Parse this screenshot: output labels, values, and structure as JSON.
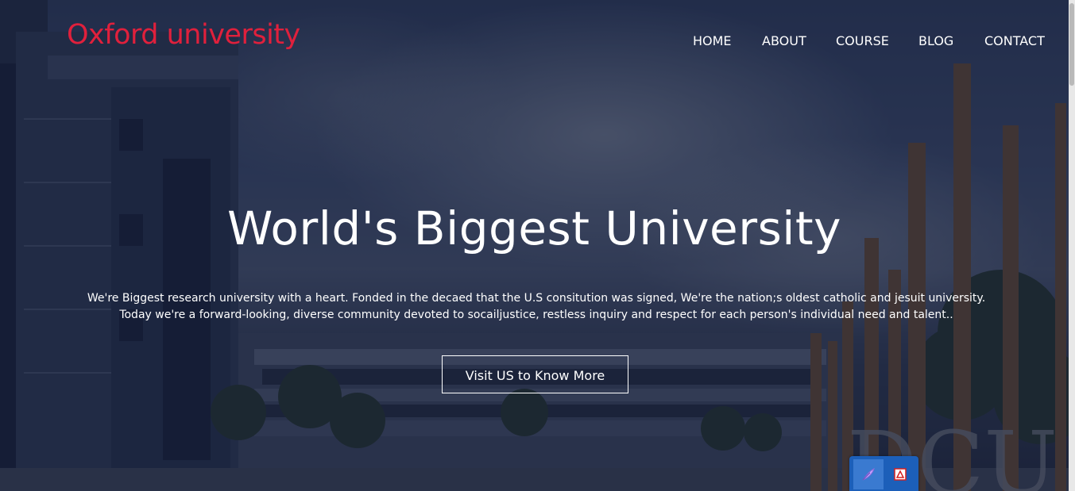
{
  "brand": {
    "name": "Oxford university",
    "color": "#e0203c"
  },
  "nav": {
    "items": [
      {
        "label": "HOME"
      },
      {
        "label": "ABOUT"
      },
      {
        "label": "COURSE"
      },
      {
        "label": "BLOG"
      },
      {
        "label": "CONTACT"
      }
    ]
  },
  "hero": {
    "headline": "World's Biggest University",
    "description": "We're Biggest research university with a heart. Fonded in the decaed that the U.S consitution was signed, We're the nation;s oldest catholic and jesuit university. Today we're a forward-looking, diverse community devoted to socailjustice, restless inquiry and respect for each person's individual need and talent..",
    "cta_label": "Visit US to Know More"
  },
  "widget": {
    "icons": [
      "feather-icon",
      "pdf-icon"
    ],
    "color": "#1c5fb9"
  }
}
